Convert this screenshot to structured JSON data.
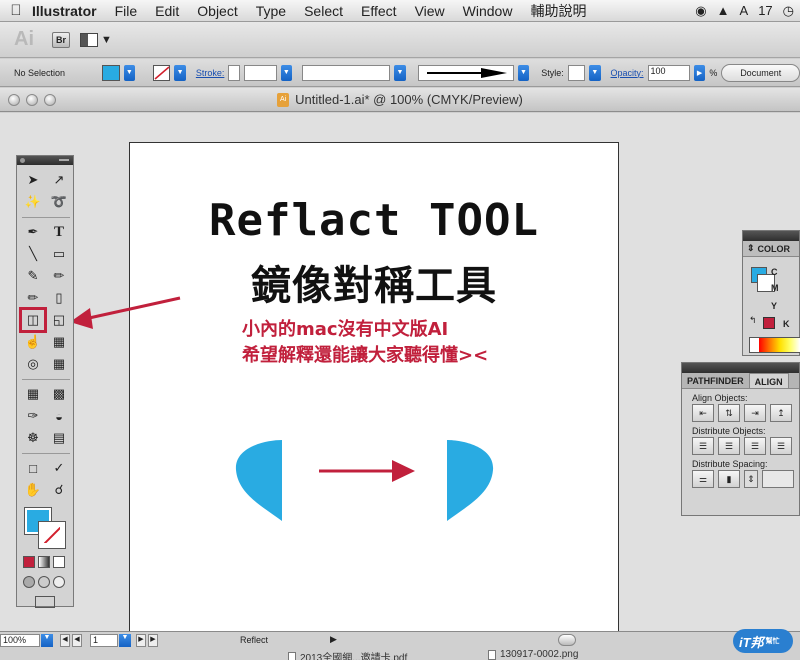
{
  "menubar": {
    "app_name": "Illustrator",
    "menus": [
      "File",
      "Edit",
      "Object",
      "Type",
      "Select",
      "Effect",
      "View",
      "Window",
      "輔助說明"
    ],
    "status_number": "17"
  },
  "controlbar": {
    "selection_label": "No Selection",
    "fill_color": "#29abe2",
    "stroke_label": "Stroke:",
    "style_label": "Style:",
    "opacity_label": "Opacity:",
    "opacity_value": "100",
    "percent": "%",
    "document_button": "Document"
  },
  "document": {
    "title": "Untitled-1.ai* @ 100% (CMYK/Preview)"
  },
  "artboard": {
    "title_en": "Reflact TOOL",
    "title_zh": "鏡像對稱工具",
    "note_line1": "小內的mac沒有中文版AI",
    "note_line2": "希望解釋還能讓大家聽得懂><",
    "shape_color": "#29abe2",
    "accent_color": "#c1203c"
  },
  "colorpanel": {
    "tab": "COLOR",
    "channels": [
      "C",
      "M",
      "Y",
      "K"
    ]
  },
  "alignpanel": {
    "tabs": [
      "PATHFINDER",
      "ALIGN"
    ],
    "align_objects": "Align Objects:",
    "distribute_objects": "Distribute Objects:",
    "distribute_spacing": "Distribute Spacing:"
  },
  "statusbar": {
    "zoom": "100%",
    "page": "1",
    "current_tool": "Reflect",
    "dock_file_1": "2013全國網...邀請卡.pdf",
    "dock_file_2": "130917-0002.png"
  },
  "watermark": {
    "text": "iT邦",
    "sub": "幫忙"
  }
}
